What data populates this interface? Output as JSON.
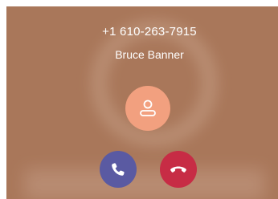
{
  "incoming_call": {
    "phone_number": "+1 610-263-7915",
    "caller_name": "Bruce Banner",
    "avatar_icon": "person-icon",
    "accept_icon": "phone-icon",
    "decline_icon": "hang-up-icon"
  },
  "colors": {
    "background": "#a9775a",
    "avatar": "#f2a07f",
    "accept": "#5a5aa2",
    "decline": "#c72c45",
    "text": "#ffffff"
  }
}
